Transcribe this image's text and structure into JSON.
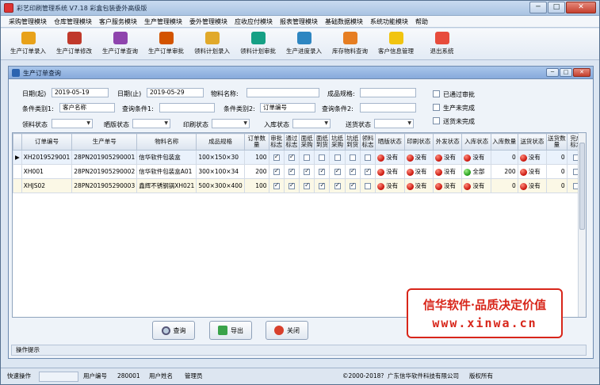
{
  "window": {
    "title": "彩艺印刷管理系统  V7.18 彩盒包装委外高级版",
    "minimize": "─",
    "maximize": "□",
    "close": "✕"
  },
  "menu": [
    "采购管理模块",
    "仓库管理模块",
    "客户服务模块",
    "生产管理模块",
    "委外管理模块",
    "应收应付模块",
    "报表管理模块",
    "基础数据模块",
    "系统功能模块",
    "帮助"
  ],
  "toolbar": [
    {
      "label": "生产订单录入",
      "icon": "order-entry-icon",
      "color": "#e8a21a"
    },
    {
      "label": "生产订单修改",
      "icon": "order-edit-icon",
      "color": "#c0392b"
    },
    {
      "label": "生产订单查询",
      "icon": "order-query-icon",
      "color": "#8e44ad"
    },
    {
      "label": "生产订单审批",
      "icon": "order-approve-icon",
      "color": "#d35400"
    },
    {
      "label": "领料计划录入",
      "icon": "material-plan-entry-icon",
      "color": "#e1a92a"
    },
    {
      "label": "领料计划审批",
      "icon": "material-plan-approve-icon",
      "color": "#16a085"
    },
    {
      "label": "生产进度录入",
      "icon": "progress-entry-icon",
      "color": "#2e86c1"
    },
    {
      "label": "库存物料查询",
      "icon": "inventory-query-icon",
      "color": "#e67e22"
    },
    {
      "label": "客户信息管理",
      "icon": "customer-info-icon",
      "color": "#f1c40f"
    },
    {
      "label": "退出系统",
      "icon": "exit-icon",
      "color": "#e74c3c"
    }
  ],
  "child": {
    "title": "生产订单查询",
    "min": "─",
    "max": "□",
    "close": "✕"
  },
  "filters": {
    "date_start_label": "日期(起)",
    "date_start": "2019-05-19",
    "date_end_label": "日期(止)",
    "date_end": "2019-05-29",
    "material_label": "物料名称:",
    "material": "",
    "product_spec_label": "成品规格:",
    "product_spec": "",
    "cat1_label": "条件类别1:",
    "cat1": "客户名称",
    "q1_label": "查询条件1:",
    "q1": "",
    "cat2_label": "条件类别2:",
    "cat2": "订单编号",
    "q2_label": "查询条件2:",
    "q2": "",
    "pick_label": "领料状态",
    "plate_label": "晒版状态",
    "print_label": "印刷状态",
    "stock_label": "入库状态",
    "deliver_label": "送货状态",
    "chk_approved": "已通过审批",
    "chk_unfinished": "生产未完成",
    "chk_undelivered": "送货未完成"
  },
  "grid": {
    "headers": [
      "订单编号",
      "生产单号",
      "物料名称",
      "成品规格",
      "订单数量",
      "审批标志",
      "通过标志",
      "面纸采购",
      "面纸到货",
      "坑纸采购",
      "坑纸到货",
      "领料标志",
      "晒版状态",
      "印刷状态",
      "外发状态",
      "入库状态",
      "入库数量",
      "送货状态",
      "送货数量",
      "完成标志"
    ],
    "rows": [
      {
        "order": "XH2019529001",
        "prod": "28PN201905290001",
        "material": "信华软件包装盒",
        "spec": "100×150×30",
        "qty": "100",
        "flags": [
          true,
          true,
          false,
          false,
          false,
          false,
          false
        ],
        "plate": "没有",
        "print": "没有",
        "outs": "没有",
        "stock": "没有",
        "stock_color": "red",
        "stock_qty": "0",
        "deliver": "没有",
        "deliver_qty": "0",
        "done": false
      },
      {
        "order": "XH001",
        "prod": "28PN201905290002",
        "material": "信华软件包装盒A01",
        "spec": "300×100×34",
        "qty": "200",
        "flags": [
          true,
          true,
          true,
          true,
          true,
          true,
          true
        ],
        "plate": "没有",
        "print": "没有",
        "outs": "没有",
        "stock": "全部",
        "stock_color": "green",
        "stock_qty": "200",
        "deliver": "没有",
        "deliver_qty": "0",
        "done": false
      },
      {
        "order": "XHJS02",
        "prod": "28PN201905290003",
        "material": "鑫辉不锈钢锅XH021",
        "spec": "500×300×400",
        "qty": "100",
        "flags": [
          true,
          true,
          true,
          true,
          true,
          true,
          false
        ],
        "plate": "没有",
        "print": "没有",
        "outs": "没有",
        "stock": "没有",
        "stock_color": "red",
        "stock_qty": "0",
        "deliver": "没有",
        "deliver_qty": "0",
        "done": false
      }
    ]
  },
  "buttons": {
    "query": "查询",
    "export": "导出",
    "close": "关闭"
  },
  "promo": {
    "line1": "信华软件·品质决定价值",
    "line2": "www.xinwa.cn"
  },
  "hint": "操作提示",
  "statusbar": {
    "quick_op": "快速操作",
    "user_no_label": "用户编号",
    "user_no": "280001",
    "user_name_label": "用户姓名",
    "user_name": "管理员",
    "copyright": "©2000-2018?",
    "company": "广东信华软件科技有限公司",
    "rights": "版权所有"
  }
}
